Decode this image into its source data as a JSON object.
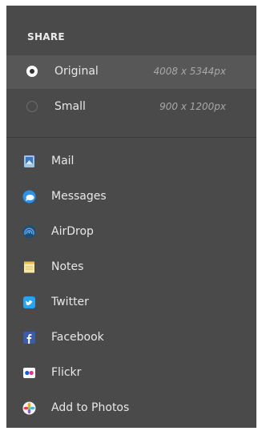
{
  "share": {
    "title": "SHARE",
    "sizes": [
      {
        "label": "Original",
        "dims": "4008 x 5344px",
        "selected": true
      },
      {
        "label": "Small",
        "dims": "900 x 1200px",
        "selected": false
      }
    ],
    "services": [
      {
        "label": "Mail",
        "icon": "mail-icon"
      },
      {
        "label": "Messages",
        "icon": "messages-icon"
      },
      {
        "label": "AirDrop",
        "icon": "airdrop-icon"
      },
      {
        "label": "Notes",
        "icon": "notes-icon"
      },
      {
        "label": "Twitter",
        "icon": "twitter-icon"
      },
      {
        "label": "Facebook",
        "icon": "facebook-icon"
      },
      {
        "label": "Flickr",
        "icon": "flickr-icon"
      },
      {
        "label": "Add to Photos",
        "icon": "photos-icon"
      }
    ]
  },
  "colors": {
    "panel_bg": "#4a4a4a",
    "selected_row_bg": "#575757",
    "text": "#e8e8e8",
    "muted_text": "#a8a8a8"
  }
}
